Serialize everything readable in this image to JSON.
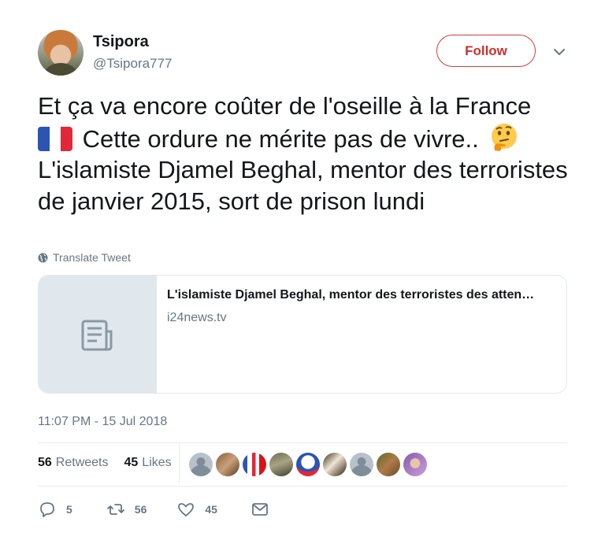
{
  "user": {
    "name": "Tsipora",
    "handle": "@Tsipora777"
  },
  "follow_label": "Follow",
  "tweet": {
    "line1": "Et ça va encore coûter de l'oseille à la France",
    "line2": "Cette ordure ne mérite pas de vivre..",
    "line3": "L'islamiste Djamel Beghal, mentor des terroristes de janvier 2015, sort de prison lundi",
    "emoji_flag": "french-flag",
    "emoji_face": "thinking-face"
  },
  "translate_label": "Translate Tweet",
  "link_card": {
    "title": "L'islamiste Djamel Beghal, mentor des terroristes des atten…",
    "domain": "i24news.tv"
  },
  "timestamp": "11:07 PM - 15 Jul 2018",
  "stats": {
    "retweets_count": "56",
    "retweets_label": "Retweets",
    "likes_count": "45",
    "likes_label": "Likes"
  },
  "actions": {
    "replies": "5",
    "retweets": "56",
    "likes": "45"
  },
  "colors": {
    "follow": "#c8322c",
    "muted": "#657786",
    "text": "#14171a",
    "border": "#e1e8ed"
  }
}
